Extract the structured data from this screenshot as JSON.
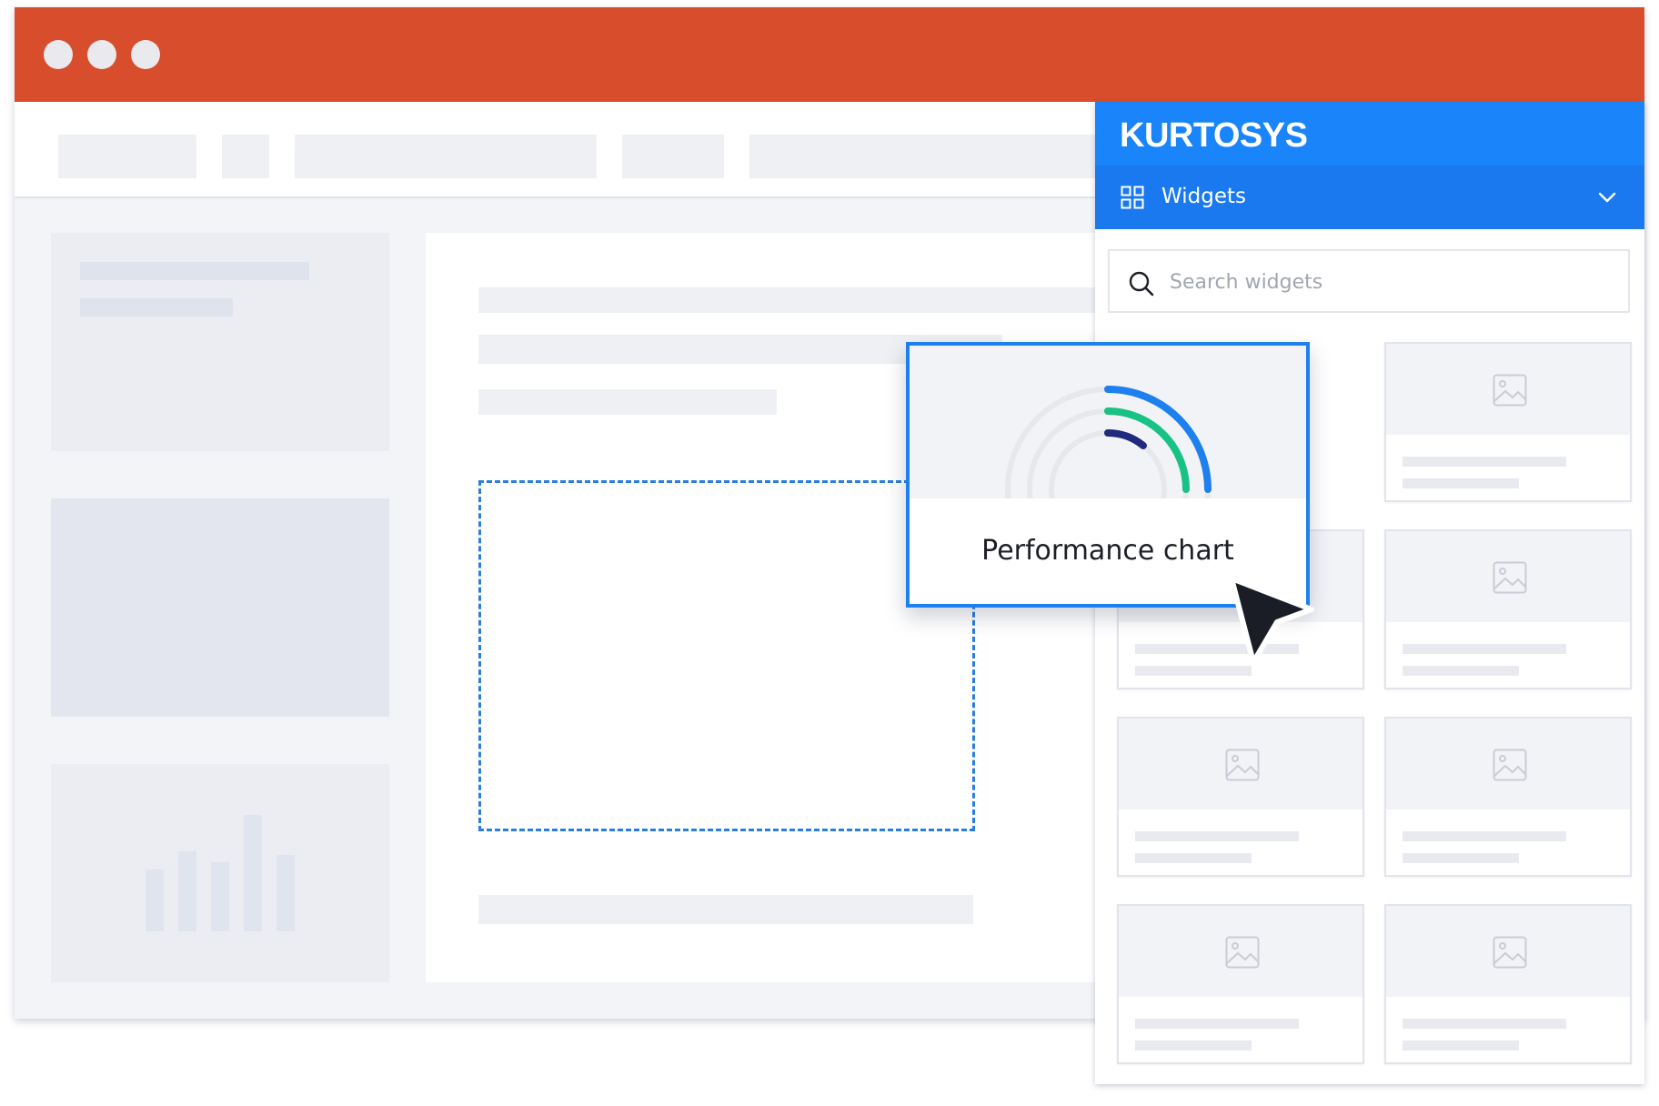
{
  "window": {
    "controls": [
      "close-dot",
      "minimize-dot",
      "maximize-dot"
    ]
  },
  "panel": {
    "logo_text": "KURTOSYS",
    "section_label": "Widgets",
    "search": {
      "placeholder": "Search widgets",
      "value": ""
    },
    "tiles_count_note": ""
  },
  "drag_widget": {
    "label": "Performance chart"
  },
  "colors": {
    "titlebar": "#d84d2c",
    "brand_blue": "#1a84fa",
    "accent_blue": "#1e7fee",
    "arc_green": "#18c184",
    "arc_navy": "#1f2a7c"
  }
}
